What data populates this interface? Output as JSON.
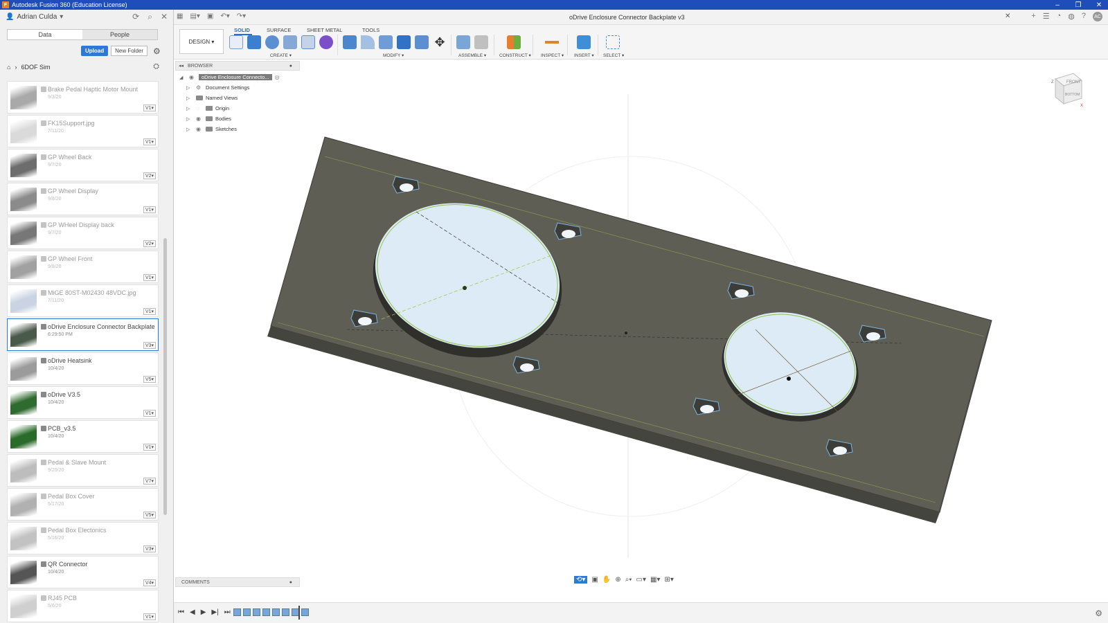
{
  "app": {
    "window_title": "Autodesk Fusion 360 (Education License)",
    "logo_letter": "F"
  },
  "data_panel": {
    "user_name": "Adrian Culda",
    "tabs": [
      "Data",
      "People"
    ],
    "upload_label": "Upload",
    "new_folder_label": "New Folder",
    "breadcrumb": "6DOF Sim",
    "files": [
      {
        "name": "Brake Pedal Haptic Motor Mount",
        "date": "9/3/20",
        "version": "V1",
        "dim": true,
        "thumb": "#a9a9a9"
      },
      {
        "name": "FK15Support.jpg",
        "date": "7/11/20",
        "version": "V1",
        "dim": true,
        "thumb": "#dadada"
      },
      {
        "name": "GP Wheel Back",
        "date": "9/7/20",
        "version": "V2",
        "dim": true,
        "thumb": "#6d6d6d"
      },
      {
        "name": "GP Wheel Display",
        "date": "9/8/20",
        "version": "V1",
        "dim": true,
        "thumb": "#8b8b8b"
      },
      {
        "name": "GP WHeel Display back",
        "date": "9/7/20",
        "version": "V2",
        "dim": true,
        "thumb": "#777777"
      },
      {
        "name": "GP Wheel Front",
        "date": "9/8/20",
        "version": "V1",
        "dim": true,
        "thumb": "#a1a1a1"
      },
      {
        "name": "MiGE 80ST-M02430 48VDC.jpg",
        "date": "7/11/20",
        "version": "V1",
        "dim": true,
        "thumb": "#c9d3e2"
      },
      {
        "name": "oDrive Enclosure Connector Backplate",
        "date": "6:29:50 PM",
        "version": "V3",
        "dim": false,
        "selected": true,
        "thumb": "#4a5a4a"
      },
      {
        "name": "oDrive Heatsink",
        "date": "10/4/20",
        "version": "V5",
        "dim": false,
        "thumb": "#9b9b9b"
      },
      {
        "name": "oDrive V3.5",
        "date": "10/4/20",
        "version": "V1",
        "dim": false,
        "thumb": "#2f6a2f"
      },
      {
        "name": "PCB_v3.5",
        "date": "10/4/20",
        "version": "V1",
        "dim": false,
        "thumb": "#2a6a2a"
      },
      {
        "name": "Pedal & Slave Mount",
        "date": "9/20/20",
        "version": "V7",
        "dim": true,
        "thumb": "#bdbdbd"
      },
      {
        "name": "Pedal Box Cover",
        "date": "5/17/20",
        "version": "V5",
        "dim": true,
        "thumb": "#b1b1b1"
      },
      {
        "name": "Pedal Box Electonics",
        "date": "5/16/20",
        "version": "V3",
        "dim": true,
        "thumb": "#c2c2c2"
      },
      {
        "name": "QR Connector",
        "date": "10/4/20",
        "version": "V4",
        "dim": false,
        "thumb": "#555555"
      },
      {
        "name": "RJ45 PCB",
        "date": "5/6/20",
        "version": "V1",
        "dim": true,
        "thumb": "#cfcfcf"
      }
    ]
  },
  "document": {
    "title": "oDrive Enclosure Connector Backplate v3",
    "user_initials": "AC"
  },
  "toolbar": {
    "design_label": "DESIGN ▾",
    "workspace_tabs": [
      "SOLID",
      "SURFACE",
      "SHEET METAL",
      "TOOLS"
    ],
    "groups": [
      "CREATE ▾",
      "MODIFY ▾",
      "ASSEMBLE ▾",
      "CONSTRUCT ▾",
      "INSPECT ▾",
      "INSERT ▾",
      "SELECT ▾"
    ]
  },
  "browser": {
    "label": "BROWSER",
    "root": "oDrive Enclosure Connecto...",
    "items": [
      "Document Settings",
      "Named Views",
      "Origin",
      "Bodies",
      "Sketches"
    ]
  },
  "comments_label": "COMMENTS",
  "viewcube": {
    "face": "FRONT",
    "side": "BOTTOM",
    "axis_x": "X",
    "axis_z": "Z"
  },
  "colors": {
    "accent": "#2d7ad6",
    "titlebar": "#1f4ebb",
    "plate": "#5e5e55",
    "hole": "#dcebf5"
  }
}
